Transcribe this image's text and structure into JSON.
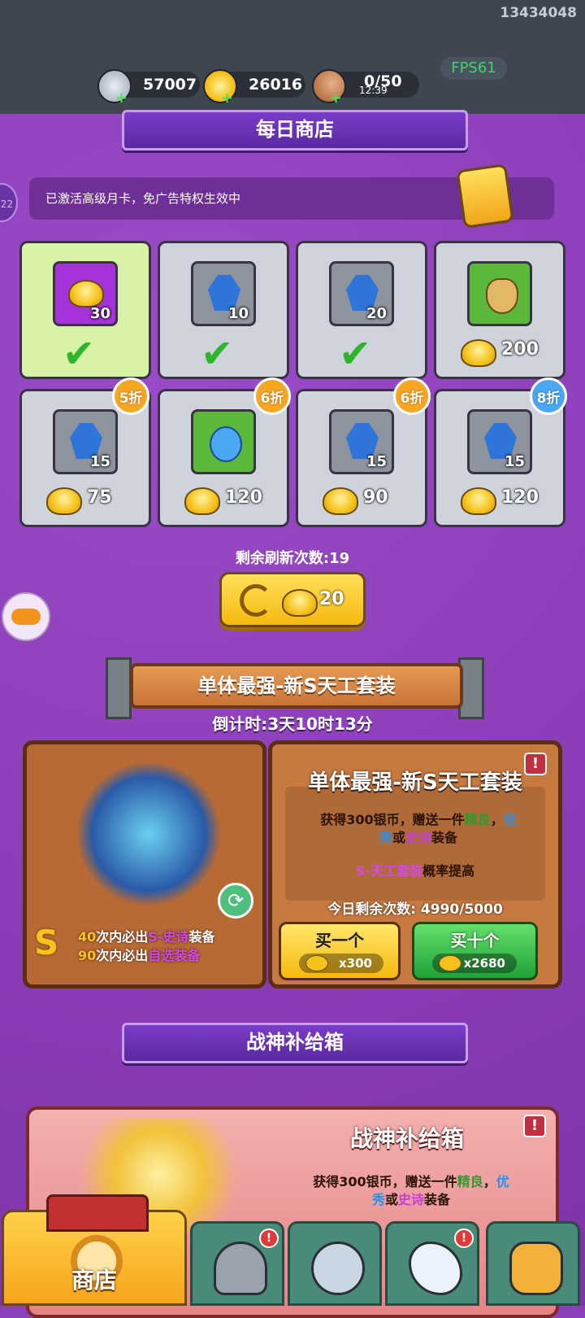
{
  "build_id": "13434048",
  "fps": "FPS61",
  "resources": {
    "silver": "57007",
    "gold": "26016",
    "stamina": "0/50",
    "stamina_timer": "12:39"
  },
  "daily_shop": {
    "title": "每日商店",
    "notice": "已激活高级月卡，免广告特权生效中",
    "side_badge": "22",
    "items": [
      {
        "icon": "gold-ingot-icon",
        "qty": "30",
        "state": "purchased"
      },
      {
        "icon": "blue-gem-icon",
        "qty": "10",
        "state": "purchased"
      },
      {
        "icon": "blue-gem-icon",
        "qty": "20",
        "state": "purchased"
      },
      {
        "icon": "amulet-icon",
        "qty": "",
        "price": "200"
      },
      {
        "icon": "armor-gem-icon",
        "qty": "15",
        "price": "75",
        "discount": "5折"
      },
      {
        "icon": "necklace-icon",
        "qty": "",
        "price": "120",
        "discount": "6折"
      },
      {
        "icon": "sword-gem-icon",
        "qty": "15",
        "price": "90",
        "discount": "6折"
      },
      {
        "icon": "medal-gem-icon",
        "qty": "15",
        "price": "120",
        "discount": "8折"
      }
    ],
    "refresh_count": "剩余刷新次数:19",
    "refresh_cost": "20"
  },
  "featured": {
    "banner": "单体最强-新S天工套装",
    "countdown": "倒计时:3天10时13分",
    "title": "单体最强-新S天工套装",
    "desc_a": "获得300银币，赠送一件",
    "desc_good": "精良",
    "desc_sep": "，",
    "desc_epic_top": "优",
    "desc_epic_bottom": "秀",
    "desc_or": "或",
    "desc_legend": "史诗",
    "desc_end": "装备",
    "rate_highlight": "S-天工套装",
    "rate_text": "概率提高",
    "remaining": "今日剩余次数: 4990/5000",
    "buy_one": "买一个",
    "buy_one_cost": "x300",
    "buy_ten": "买十个",
    "buy_ten_cost": "x2680",
    "guarantee_1_num": "40",
    "guarantee_1_text": "次内必出",
    "guarantee_1_item": "S-史诗",
    "guarantee_1_end": "装备",
    "guarantee_2_num": "90",
    "guarantee_2_text": "次内必出",
    "guarantee_2_item": "自选装备",
    "alert": "!"
  },
  "supply": {
    "banner": "战神补给箱",
    "title": "战神补给箱",
    "desc_a": "获得300银币，赠送一件",
    "desc_good": "精良",
    "desc_epic_top": "优",
    "desc_epic_bottom": "秀",
    "desc_or": "或",
    "desc_legend": "史诗",
    "desc_end": "装备",
    "alert": "!"
  },
  "bottom_nav": {
    "shop_label": "商店",
    "tabs": [
      "helmet-icon",
      "crossed-swords-icon",
      "wing-icon",
      "fist-upgrade-icon"
    ],
    "alert": "!"
  },
  "colors": {
    "background": "#8b3fb8",
    "gold": "#f6b90f",
    "green": "#21a23a",
    "good_text": "#2f9a2f",
    "epic_text": "#2a8fe6",
    "legend_text": "#c23fd8"
  }
}
